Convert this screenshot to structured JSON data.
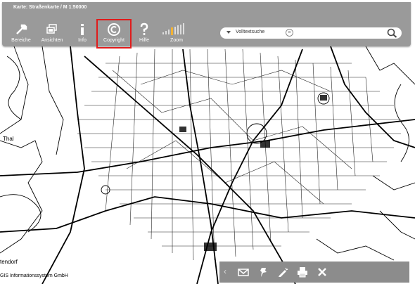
{
  "window_title": "Karte: Straßenkarte / M 1:50000",
  "toolbar": {
    "tools": [
      {
        "label": "Bereiche"
      },
      {
        "label": "Ansichten"
      },
      {
        "label": "Info"
      },
      {
        "label": "Copyright"
      },
      {
        "label": "Hilfe"
      },
      {
        "label": "Zoom"
      }
    ],
    "selected": "Copyright"
  },
  "search": {
    "placeholder": "Volltextsuche"
  },
  "map": {
    "place_labels": [
      "Thal",
      "tendorf"
    ],
    "footer_text": "GIS Informationssystem GmbH"
  },
  "colors": {
    "toolbar": "#9a9a9a",
    "highlight": "#e11b1b",
    "zoom_accent": "#f2b233"
  }
}
